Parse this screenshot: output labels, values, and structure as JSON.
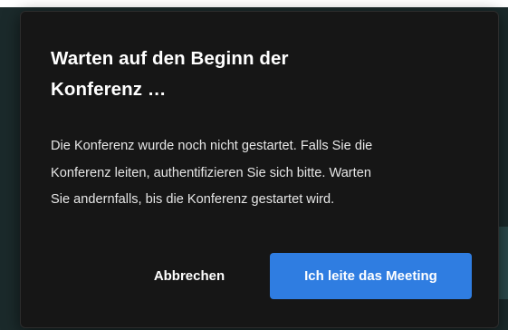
{
  "dialog": {
    "title_line1": "Warten auf den Beginn der",
    "title_line2": "Konferenz …",
    "body_line1": "Die Konferenz wurde noch nicht gestartet. Falls Sie die",
    "body_line2": "Konferenz leiten, authentifizieren Sie sich bitte. Warten",
    "body_line3": "Sie andernfalls, bis die Konferenz gestartet wird.",
    "cancel_label": "Abbrechen",
    "primary_label": "Ich leite das Meeting"
  },
  "colors": {
    "dialog_background": "#161616",
    "primary_button": "#2f7de1",
    "text": "#ffffff"
  }
}
